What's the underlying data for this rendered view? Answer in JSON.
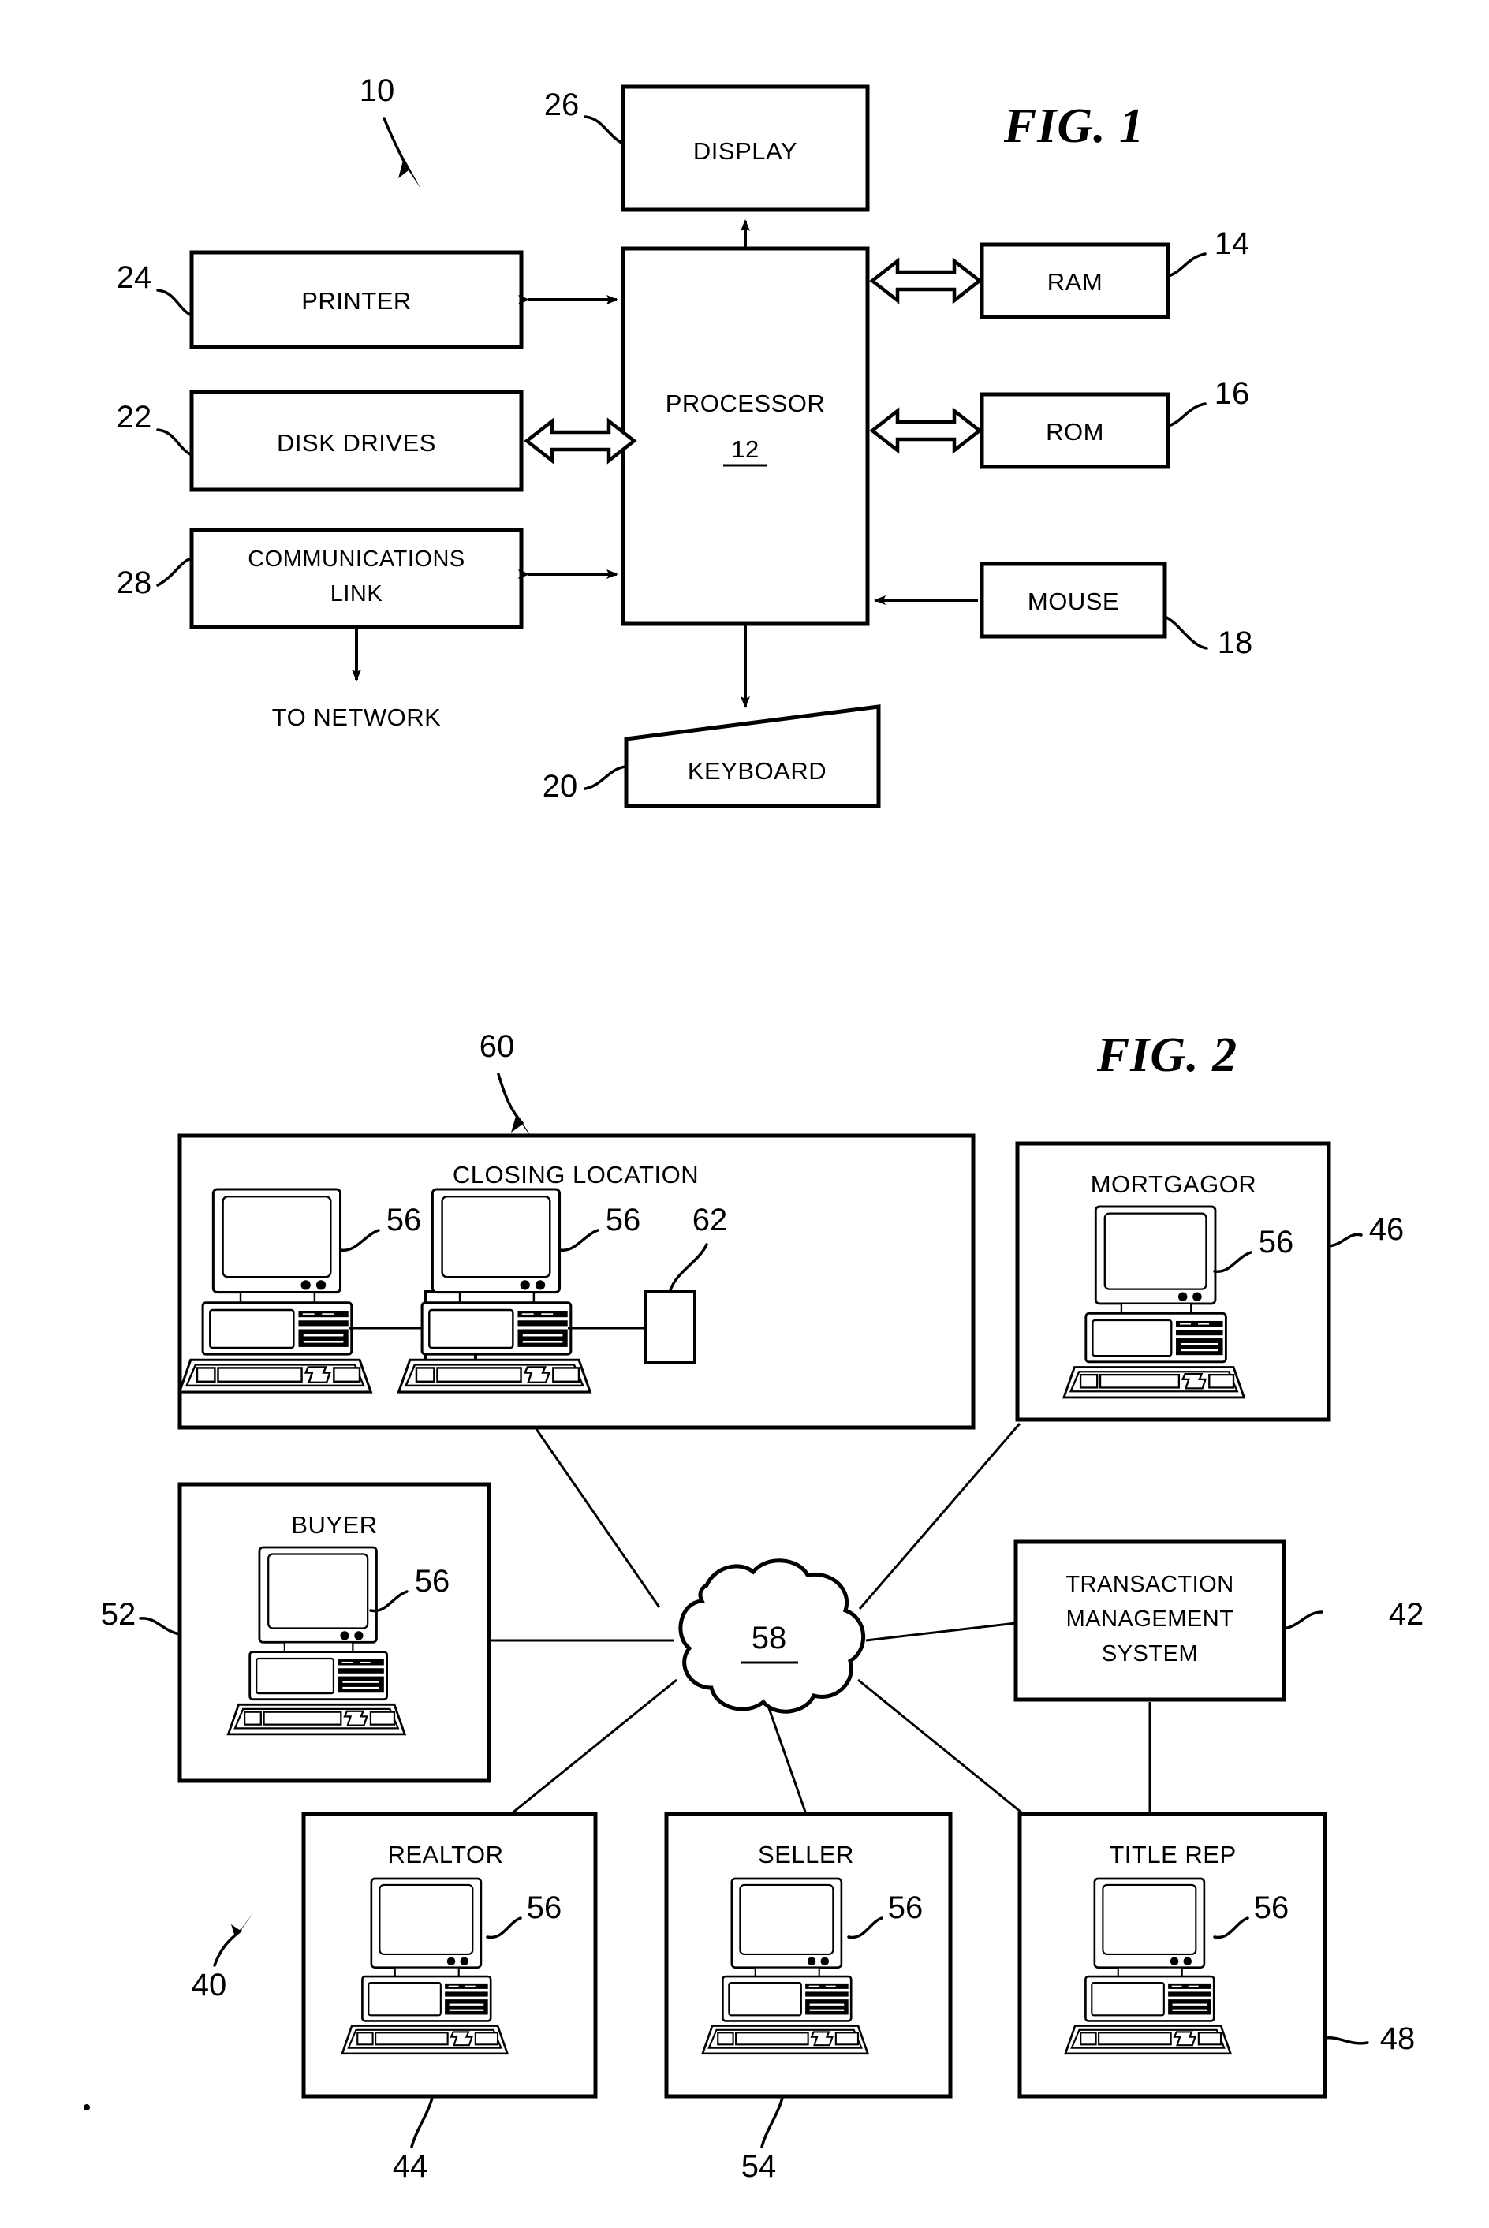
{
  "figures": [
    {
      "id": "fig1",
      "title": "FIG. 1",
      "system_ref": "10",
      "blocks": [
        {
          "key": "display",
          "label": "DISPLAY",
          "ref": "26"
        },
        {
          "key": "printer",
          "label": "PRINTER",
          "ref": "24"
        },
        {
          "key": "processor",
          "label": "PROCESSOR",
          "ref": "12"
        },
        {
          "key": "disk",
          "label": "DISK DRIVES",
          "ref": "22"
        },
        {
          "key": "comm",
          "label_line1": "COMMUNICATIONS",
          "label_line2": "LINK",
          "ref": "28"
        },
        {
          "key": "ram",
          "label": "RAM",
          "ref": "14"
        },
        {
          "key": "rom",
          "label": "ROM",
          "ref": "16"
        },
        {
          "key": "mouse",
          "label": "MOUSE",
          "ref": "18"
        },
        {
          "key": "keyboard",
          "label": "KEYBOARD",
          "ref": "20"
        }
      ],
      "annotations": [
        {
          "key": "to_network",
          "text": "TO NETWORK"
        }
      ]
    },
    {
      "id": "fig2",
      "title": "FIG. 2",
      "system_ref": "40",
      "closing_ref": "60",
      "blocks": [
        {
          "key": "closing",
          "label": "CLOSING LOCATION",
          "ref": "60",
          "workstation_ref": "56",
          "device_ref": "62",
          "workstations": 2
        },
        {
          "key": "mortgagor",
          "label": "MORTGAGOR",
          "ref": "46",
          "workstation_ref": "56"
        },
        {
          "key": "buyer",
          "label": "BUYER",
          "ref": "52",
          "workstation_ref": "56"
        },
        {
          "key": "tms",
          "label_line1": "TRANSACTION",
          "label_line2": "MANAGEMENT",
          "label_line3": "SYSTEM",
          "ref": "42"
        },
        {
          "key": "realtor",
          "label": "REALTOR",
          "ref": "44",
          "workstation_ref": "56"
        },
        {
          "key": "seller",
          "label": "SELLER",
          "ref": "54",
          "workstation_ref": "56"
        },
        {
          "key": "titlerep",
          "label": "TITLE REP",
          "ref": "48",
          "workstation_ref": "56"
        },
        {
          "key": "network",
          "label": "58",
          "ref": "58"
        }
      ]
    }
  ],
  "colors": {
    "ink": "#000000",
    "paper": "#ffffff"
  }
}
